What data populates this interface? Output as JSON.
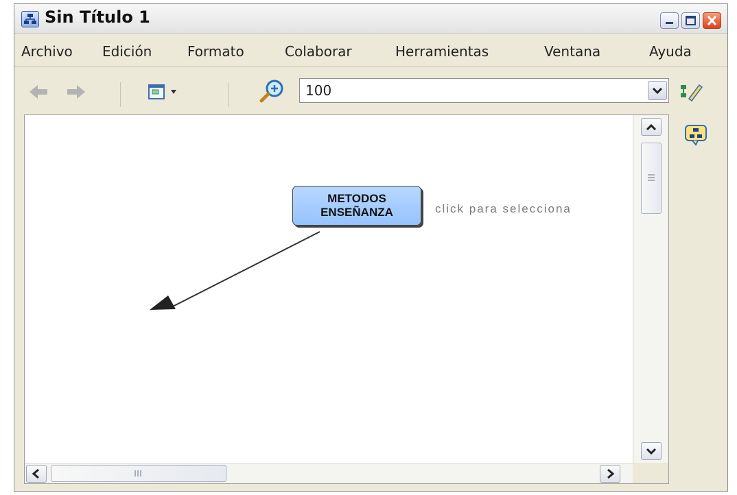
{
  "window": {
    "title": "Sin Título 1"
  },
  "menu": {
    "items": [
      "Archivo",
      "Edición",
      "Formato",
      "Colaborar",
      "Herramientas",
      "Ventana",
      "Ayuda"
    ]
  },
  "toolbar": {
    "zoom_value": "100"
  },
  "canvas": {
    "concept_line1": "METODOS",
    "concept_line2": "ENSEÑANZA",
    "hint": "click para selecciona"
  },
  "icons": {
    "app": "concept-map-icon",
    "back": "back-arrow-icon",
    "forward": "forward-arrow-icon",
    "view": "view-window-icon",
    "zoom": "zoom-in-icon",
    "styles": "styles-edit-icon",
    "panel": "concept-panel-icon"
  },
  "colors": {
    "concept_fill": "#9ec8ff",
    "close_button": "#d8471e"
  }
}
